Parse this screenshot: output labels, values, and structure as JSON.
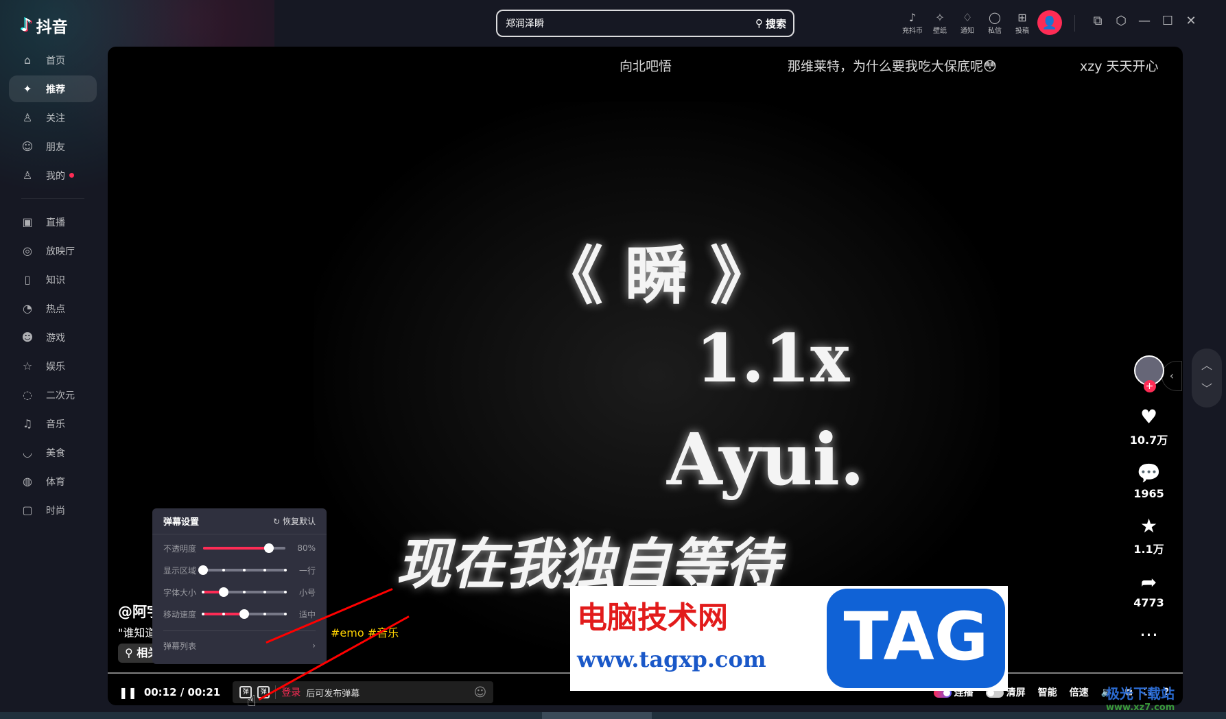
{
  "app": {
    "name": "抖音"
  },
  "sidebar": {
    "items": [
      {
        "label": "首页",
        "icon": "home-icon",
        "g": "⌂"
      },
      {
        "label": "推荐",
        "icon": "sparkle-icon",
        "g": "✦",
        "active": true
      },
      {
        "label": "关注",
        "icon": "follow-icon",
        "g": "♙"
      },
      {
        "label": "朋友",
        "icon": "friends-icon",
        "g": "☺"
      },
      {
        "label": "我的",
        "icon": "user-icon",
        "g": "♙",
        "dot": true
      }
    ],
    "items2": [
      {
        "label": "直播",
        "icon": "tv-icon",
        "g": "▣"
      },
      {
        "label": "放映厅",
        "icon": "film-icon",
        "g": "◎"
      },
      {
        "label": "知识",
        "icon": "book-icon",
        "g": "▯"
      },
      {
        "label": "热点",
        "icon": "fire-icon",
        "g": "◔"
      },
      {
        "label": "游戏",
        "icon": "gamepad-icon",
        "g": "☻"
      },
      {
        "label": "娱乐",
        "icon": "star-icon",
        "g": "☆"
      },
      {
        "label": "二次元",
        "icon": "ghost-icon",
        "g": "◌"
      },
      {
        "label": "音乐",
        "icon": "music-icon",
        "g": "♫"
      },
      {
        "label": "美食",
        "icon": "food-icon",
        "g": "◡"
      },
      {
        "label": "体育",
        "icon": "ball-icon",
        "g": "◍"
      },
      {
        "label": "时尚",
        "icon": "bag-icon",
        "g": "▢"
      }
    ]
  },
  "search": {
    "value": "郑润泽瞬",
    "button": "搜索"
  },
  "topbar": {
    "items": [
      {
        "label": "充抖币",
        "icon": "coin-icon",
        "g": "♪"
      },
      {
        "label": "壁纸",
        "icon": "wallpaper-icon",
        "g": "✧"
      },
      {
        "label": "通知",
        "icon": "bell-icon",
        "g": "♢"
      },
      {
        "label": "私信",
        "icon": "message-icon",
        "g": "◯"
      },
      {
        "label": "投稿",
        "icon": "upload-icon",
        "g": "⊞"
      }
    ]
  },
  "danmaku": [
    "向北吧悟",
    "那维莱特，为什么要我吃大保底呢😳",
    "xzy 天天开心"
  ],
  "video": {
    "lines": [
      "《 瞬 》",
      "1.1x",
      "Ayui.",
      "现在我独自等待"
    ],
    "author": "@阿宇",
    "desc": "\"谁知道",
    "tags": "#emo  #音乐",
    "related": "相关"
  },
  "actions": {
    "likes": "10.7万",
    "comments": "1965",
    "favorites": "1.1万",
    "shares": "4773"
  },
  "player": {
    "time": "00:12 / 00:21",
    "login": "登录",
    "post_hint": "后可发布弹幕",
    "autoplay": "连播",
    "clear": "清屏",
    "smart": "智能",
    "speed": "倍速",
    "accent": "#fe2c55"
  },
  "panel": {
    "title": "弹幕设置",
    "reset": "恢复默认",
    "rows": [
      {
        "label": "不透明度",
        "value": "80%",
        "level": 0.8
      },
      {
        "label": "显示区域",
        "value": "一行",
        "level": 0
      },
      {
        "label": "字体大小",
        "value": "小号",
        "level": 0.25
      },
      {
        "label": "移动速度",
        "value": "适中",
        "level": 0.5
      }
    ],
    "list": "弹幕列表"
  },
  "watermark": {
    "cn": "电脑技术网",
    "url": "www.tagxp.com",
    "tag": "TAG",
    "cn2": "极光下载站",
    "url2": "www.xz7.com"
  }
}
